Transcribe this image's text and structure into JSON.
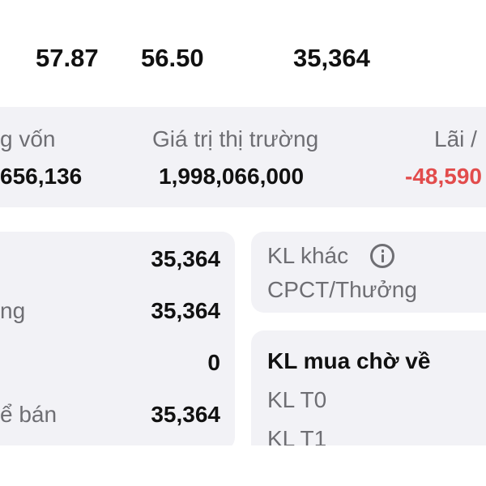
{
  "top_row": {
    "value_1": "57.87",
    "value_2": "56.50",
    "value_3": "35,364"
  },
  "summary": {
    "cost_label": "g vốn",
    "cost_value": "656,136",
    "market_label": "Giá trị thị trường",
    "market_value": "1,998,066,000",
    "pnl_label": "Lãi /",
    "pnl_value": "-48,590"
  },
  "left_card": {
    "rows": [
      {
        "label": "",
        "value": "35,364"
      },
      {
        "label": "ng",
        "value": "35,364"
      },
      {
        "label": "",
        "value": "0"
      },
      {
        "label": "ể bán",
        "value": "35,364"
      }
    ]
  },
  "other_card": {
    "title": "KL khác",
    "subtitle": "CPCT/Thưởng",
    "icon": "info-icon"
  },
  "pending_card": {
    "title": "KL mua chờ về",
    "items": [
      "KL T0",
      "KL T1"
    ]
  },
  "colors": {
    "negative": "#e24c4c",
    "card_bg": "#f2f2f6",
    "muted_text": "#6e6e73"
  }
}
